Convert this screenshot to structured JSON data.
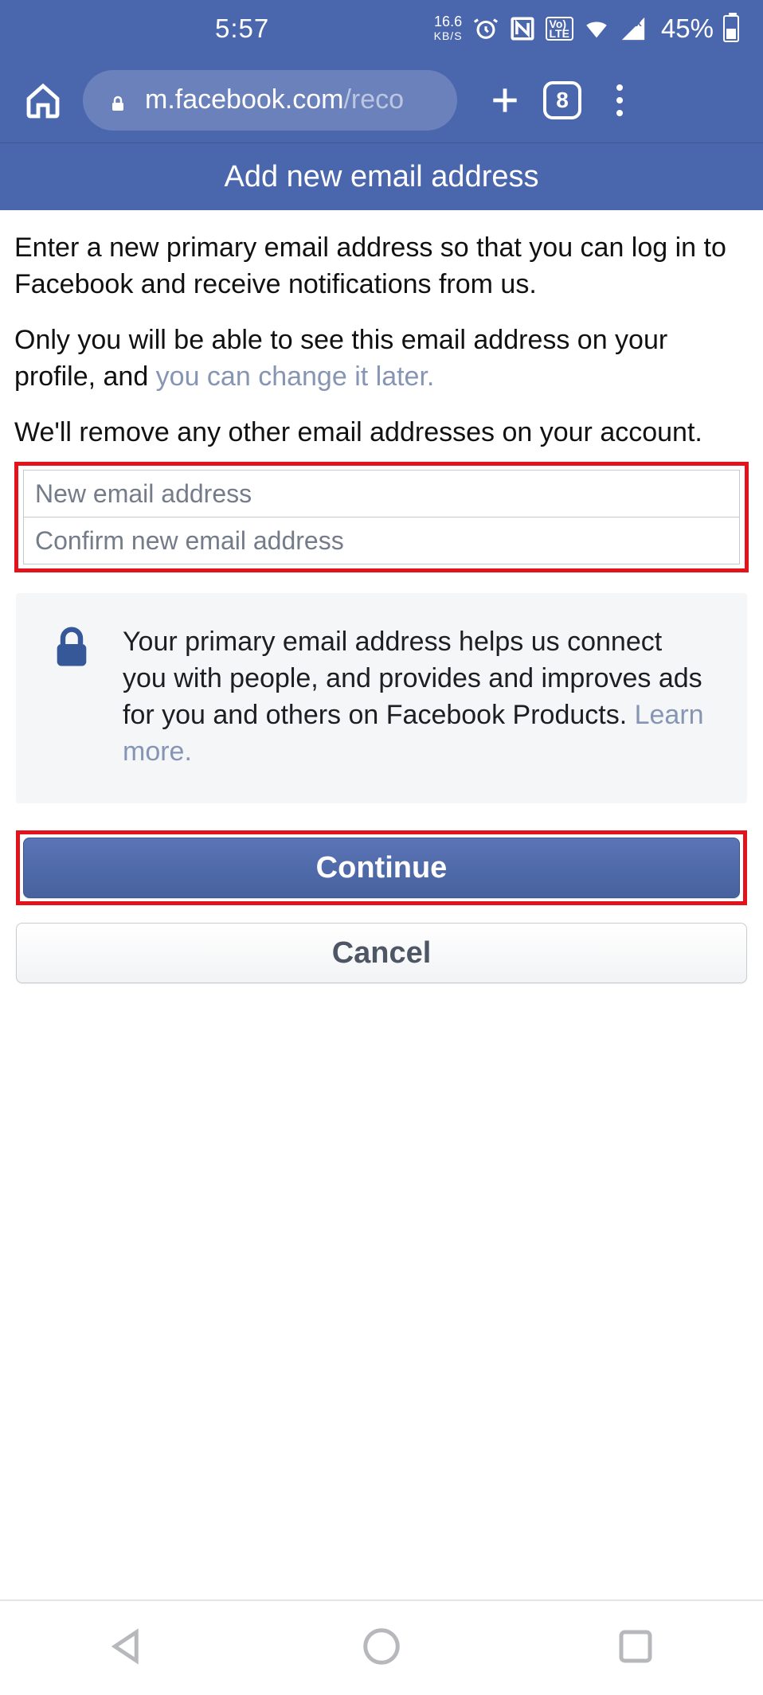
{
  "status": {
    "time": "5:57",
    "net_speed": "16.6",
    "net_unit": "KB/S",
    "battery_pct": "45%"
  },
  "browser": {
    "url_host": "m.facebook.com",
    "url_path": "/reco",
    "tab_count": "8"
  },
  "header": {
    "title": "Add new email address"
  },
  "body": {
    "para1": "Enter a new primary email address so that you can log in to Facebook and receive notifications from us.",
    "para2_a": "Only you will be able to see this email address on your profile, and ",
    "para2_link": "you can change it later.",
    "para3": "We'll remove any other email addresses on your account."
  },
  "inputs": {
    "new_email_placeholder": "New email address",
    "confirm_email_placeholder": "Confirm new email address"
  },
  "info": {
    "text": "Your primary email address helps us connect you with people, and provides and improves ads for you and others on Facebook Products. ",
    "learn_more": "Learn more."
  },
  "buttons": {
    "continue": "Continue",
    "cancel": "Cancel"
  },
  "colors": {
    "fb_blue": "#4a66ad",
    "highlight_red": "#e3131b"
  }
}
